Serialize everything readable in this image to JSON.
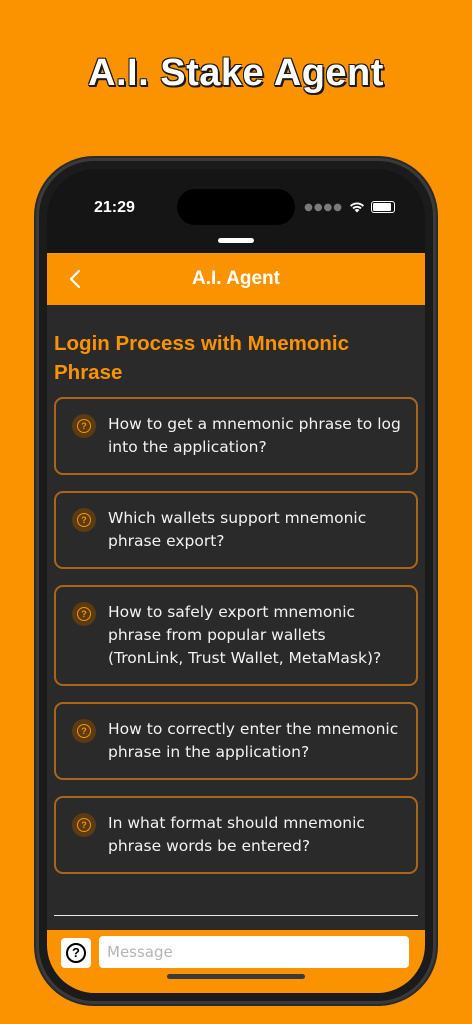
{
  "promo": {
    "headline": "A.I. Stake Agent"
  },
  "status_bar": {
    "time": "21:29",
    "signal_icon": "signal-dots-icon",
    "wifi_icon": "wifi-icon",
    "battery_icon": "battery-icon"
  },
  "app_bar": {
    "title": "A.I. Agent",
    "back_icon": "chevron-left-icon"
  },
  "section": {
    "title": "Login Process with Mnemonic Phrase"
  },
  "questions": [
    {
      "icon": "question-circle-icon",
      "text": "How to get a mnemonic phrase to log into the application?"
    },
    {
      "icon": "question-circle-icon",
      "text": "Which wallets support mnemonic phrase export?"
    },
    {
      "icon": "question-circle-icon",
      "text": "How to safely export mnemonic phrase from popular wallets (TronLink, Trust Wallet, MetaMask)?"
    },
    {
      "icon": "question-circle-icon",
      "text": "How to correctly enter the mnemonic phrase in the application?"
    },
    {
      "icon": "question-circle-icon",
      "text": "In what format should mnemonic phrase words be entered?"
    }
  ],
  "composer": {
    "help_icon": "help-circle-icon",
    "help_glyph": "?",
    "message_value": "",
    "message_placeholder": "Message"
  },
  "colors": {
    "accent": "#FB9300",
    "panel": "#2A2A2A",
    "card_border": "#A9661A",
    "text": "#F2F2F2"
  }
}
